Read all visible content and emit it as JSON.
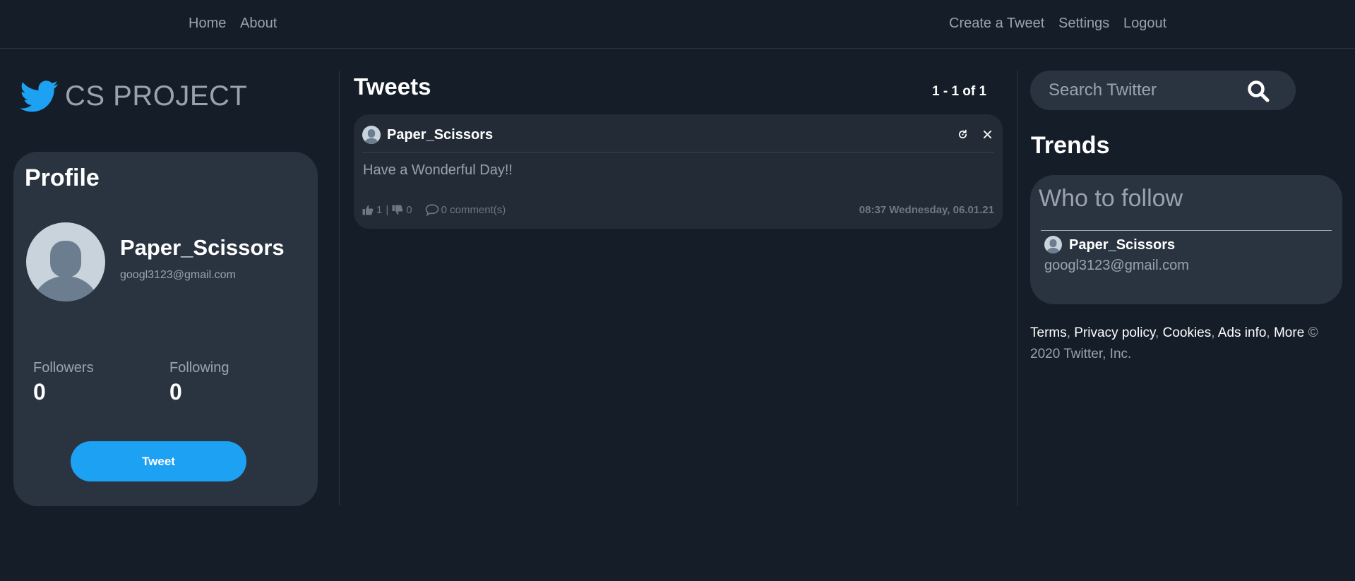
{
  "navbar": {
    "home": "Home",
    "about": "About",
    "create_tweet": "Create a Tweet",
    "settings": "Settings",
    "logout": "Logout"
  },
  "brand": {
    "title": "CS PROJECT",
    "logo_color": "#1da1f2"
  },
  "profile": {
    "heading": "Profile",
    "name": "Paper_Scissors",
    "email": "googl3123@gmail.com",
    "followers_label": "Followers",
    "followers_count": "0",
    "following_label": "Following",
    "following_count": "0",
    "tweet_button": "Tweet"
  },
  "tweets": {
    "heading": "Tweets",
    "pagination": "1 - 1 of 1",
    "items": [
      {
        "user": "Paper_Scissors",
        "text": "Have a Wonderful Day!!",
        "likes": "1",
        "separator": "|",
        "dislikes": "0",
        "comments": "0 comment(s)",
        "date": "08:37 Wednesday, 06.01.21"
      }
    ]
  },
  "search": {
    "placeholder": "Search Twitter"
  },
  "trends": {
    "heading": "Trends",
    "who_to_follow": {
      "heading": "Who to follow",
      "name": "Paper_Scissors",
      "email": "googl3123@gmail.com"
    }
  },
  "footer": {
    "terms": "Terms",
    "privacy": "Privacy policy",
    "cookies": "Cookies",
    "ads": "Ads info",
    "more": "More",
    "copyright": "© 2020 Twitter, Inc."
  },
  "colors": {
    "background": "#151e28",
    "card": "#2a3440",
    "accent": "#1da1f2"
  }
}
